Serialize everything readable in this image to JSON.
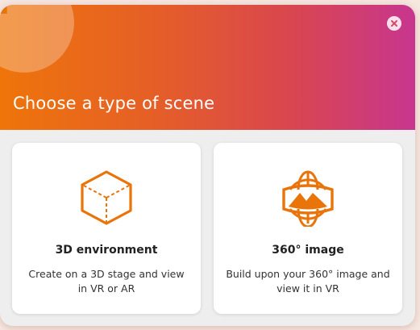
{
  "dialog": {
    "title": "Choose a type of scene",
    "help_mark": "?",
    "close_icon": "close-icon",
    "colors": {
      "gradient_start": "#ee750a",
      "gradient_end": "#c7368f",
      "accent": "#e8740a"
    }
  },
  "options": [
    {
      "icon": "cube-icon",
      "title": "3D environment",
      "description": "Create on a 3D stage and view in VR or AR"
    },
    {
      "icon": "panorama-globe-icon",
      "title": "360° image",
      "description": "Build upon your 360° image and view it in VR"
    }
  ]
}
